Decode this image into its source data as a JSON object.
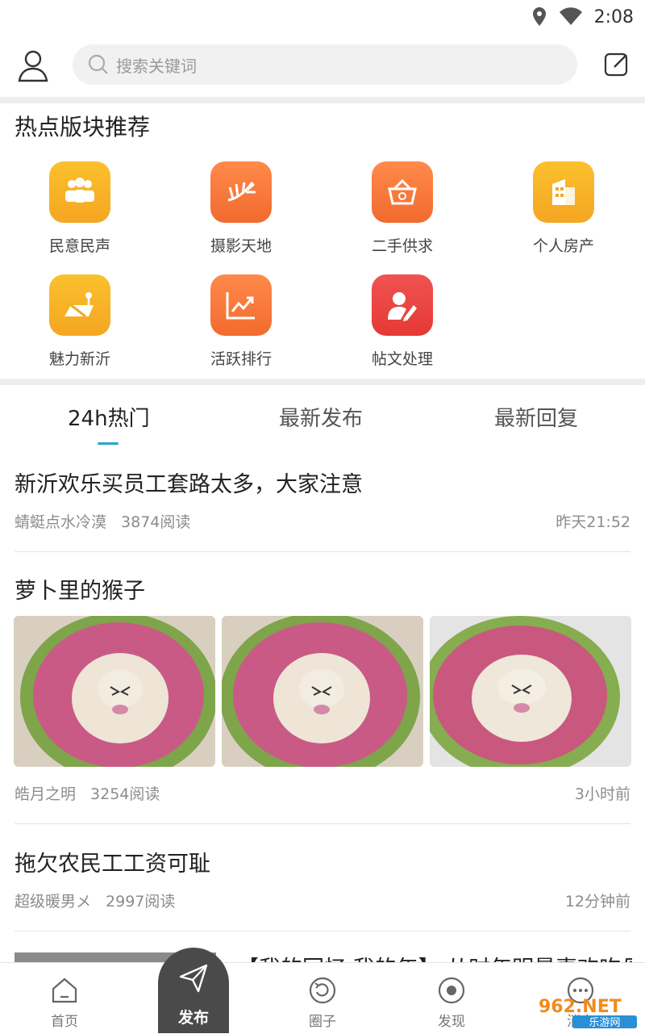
{
  "status_bar": {
    "time": "2:08",
    "icons": [
      "location-icon",
      "wifi-icon"
    ]
  },
  "header": {
    "search_placeholder": "搜索关键词",
    "left_icon": "user-icon",
    "right_icon": "compose-icon"
  },
  "hot_section": {
    "title": "热点版块推荐",
    "items": [
      {
        "label": "民意民声",
        "icon": "people-icon",
        "color": "#f5a623"
      },
      {
        "label": "摄影天地",
        "icon": "palm-leaf-icon",
        "color": "#f26a2e"
      },
      {
        "label": "二手供求",
        "icon": "basket-icon",
        "color": "#f26a2e"
      },
      {
        "label": "个人房产",
        "icon": "building-icon",
        "color": "#f5a623"
      },
      {
        "label": "魅力新沂",
        "icon": "map-pin-icon",
        "color": "#f5a623"
      },
      {
        "label": "活跃排行",
        "icon": "trend-chart-icon",
        "color": "#f26a2e"
      },
      {
        "label": "帖文处理",
        "icon": "user-edit-icon",
        "color": "#e53935"
      }
    ]
  },
  "tabs": [
    {
      "label": "24h热门",
      "active": true
    },
    {
      "label": "最新发布",
      "active": false
    },
    {
      "label": "最新回复",
      "active": false
    }
  ],
  "posts": [
    {
      "title": "新沂欢乐买员工套路太多，大家注意",
      "author": "蜻蜓点水冷漠",
      "reads": "3874阅读",
      "time": "昨天21:52"
    },
    {
      "title": "萝卜里的猴子",
      "author": "皓月之明",
      "reads": "3254阅读",
      "time": "3小时前"
    },
    {
      "title": "拖欠农民工工资可耻",
      "author": "超级暖男メ",
      "reads": "2997阅读",
      "time": "12分钟前"
    },
    {
      "title": "【我的回忆 我的年】 从时年明最喜欢吃母"
    }
  ],
  "bottom_nav": {
    "items": [
      {
        "label": "首页",
        "icon": "home-icon"
      },
      {
        "label": "发布",
        "icon": "send-icon"
      },
      {
        "label": "圈子",
        "icon": "circle-refresh-icon"
      },
      {
        "label": "发现",
        "icon": "compass-icon"
      },
      {
        "label": "消息",
        "icon": "chat-bubble-icon"
      }
    ]
  },
  "watermark": {
    "brand": "962.NET",
    "sub": "乐游网"
  },
  "colors": {
    "accent": "#2aa6c8",
    "yellow_tile": "#f5a623",
    "orange_tile": "#f26a2e",
    "red_tile": "#e53935",
    "publish_bg": "#4a4a4a"
  }
}
